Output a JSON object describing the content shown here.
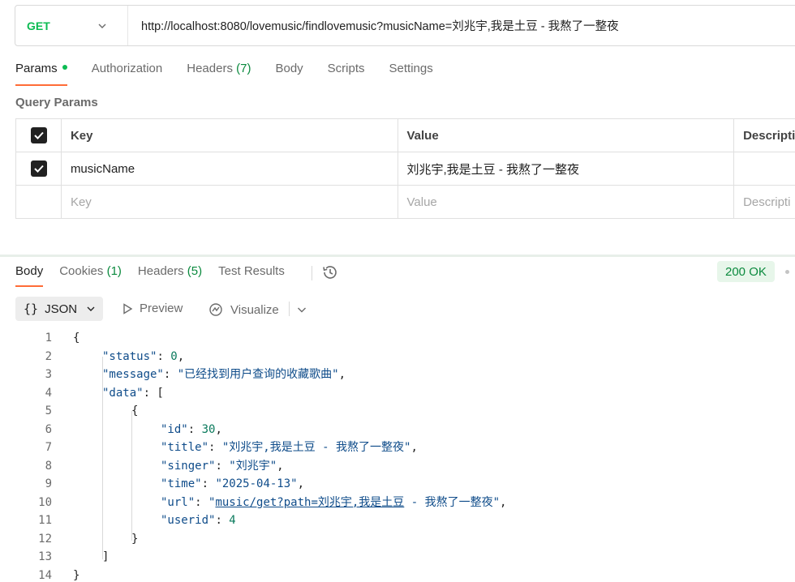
{
  "request": {
    "method": "GET",
    "url": "http://localhost:8080/lovemusic/findlovemusic?musicName=刘兆宇,我是土豆 - 我熬了一整夜"
  },
  "request_tabs": [
    {
      "label": "Params",
      "count": ""
    },
    {
      "label": "Authorization",
      "count": ""
    },
    {
      "label": "Headers",
      "count": "(7)"
    },
    {
      "label": "Body",
      "count": ""
    },
    {
      "label": "Scripts",
      "count": ""
    },
    {
      "label": "Settings",
      "count": ""
    }
  ],
  "query_params": {
    "title": "Query Params",
    "columns": [
      "Key",
      "Value",
      "Descripti"
    ],
    "rows": [
      {
        "checked": true,
        "key": "musicName",
        "value": "刘兆宇,我是土豆 - 我熬了一整夜",
        "description": ""
      }
    ],
    "placeholders": {
      "key": "Key",
      "value": "Value",
      "description": "Descripti"
    }
  },
  "response_tabs": [
    {
      "label": "Body",
      "count": ""
    },
    {
      "label": "Cookies",
      "count": "(1)"
    },
    {
      "label": "Headers",
      "count": "(5)"
    },
    {
      "label": "Test Results",
      "count": ""
    }
  ],
  "status": "200 OK",
  "toolbar": {
    "format": "JSON",
    "preview": "Preview",
    "visualize": "Visualize"
  },
  "code_lines": [
    {
      "n": "1",
      "indent": 0,
      "parts": [
        [
          "p",
          "{"
        ]
      ]
    },
    {
      "n": "2",
      "indent": 1,
      "parts": [
        [
          "k",
          "\"status\""
        ],
        [
          "p",
          ": "
        ],
        [
          "n",
          "0"
        ],
        [
          "p",
          ","
        ]
      ]
    },
    {
      "n": "3",
      "indent": 1,
      "parts": [
        [
          "k",
          "\"message\""
        ],
        [
          "p",
          ": "
        ],
        [
          "s",
          "\"已经找到用户查询的收藏歌曲\""
        ],
        [
          "p",
          ","
        ]
      ]
    },
    {
      "n": "4",
      "indent": 1,
      "parts": [
        [
          "k",
          "\"data\""
        ],
        [
          "p",
          ": ["
        ]
      ]
    },
    {
      "n": "5",
      "indent": 2,
      "parts": [
        [
          "p",
          "{"
        ]
      ]
    },
    {
      "n": "6",
      "indent": 3,
      "parts": [
        [
          "k",
          "\"id\""
        ],
        [
          "p",
          ": "
        ],
        [
          "n",
          "30"
        ],
        [
          "p",
          ","
        ]
      ]
    },
    {
      "n": "7",
      "indent": 3,
      "parts": [
        [
          "k",
          "\"title\""
        ],
        [
          "p",
          ": "
        ],
        [
          "s",
          "\"刘兆宇,我是土豆 - 我熬了一整夜\""
        ],
        [
          "p",
          ","
        ]
      ]
    },
    {
      "n": "8",
      "indent": 3,
      "parts": [
        [
          "k",
          "\"singer\""
        ],
        [
          "p",
          ": "
        ],
        [
          "s",
          "\"刘兆宇\""
        ],
        [
          "p",
          ","
        ]
      ]
    },
    {
      "n": "9",
      "indent": 3,
      "parts": [
        [
          "k",
          "\"time\""
        ],
        [
          "p",
          ": "
        ],
        [
          "s",
          "\"2025-04-13\""
        ],
        [
          "p",
          ","
        ]
      ]
    },
    {
      "n": "10",
      "indent": 3,
      "parts": [
        [
          "k",
          "\"url\""
        ],
        [
          "p",
          ": "
        ],
        [
          "s",
          "\""
        ],
        [
          "su",
          "music/get?path=刘兆宇,我是土豆"
        ],
        [
          "s",
          " - 我熬了一整夜\""
        ],
        [
          "p",
          ","
        ]
      ]
    },
    {
      "n": "11",
      "indent": 3,
      "parts": [
        [
          "k",
          "\"userid\""
        ],
        [
          "p",
          ": "
        ],
        [
          "n",
          "4"
        ]
      ]
    },
    {
      "n": "12",
      "indent": 2,
      "parts": [
        [
          "p",
          "}"
        ]
      ]
    },
    {
      "n": "13",
      "indent": 1,
      "parts": [
        [
          "p",
          "]"
        ]
      ]
    },
    {
      "n": "14",
      "indent": 0,
      "parts": [
        [
          "p",
          "}"
        ]
      ]
    }
  ]
}
